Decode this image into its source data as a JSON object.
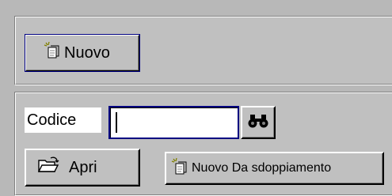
{
  "top_section": {
    "new_button_label": "Nuovo"
  },
  "search_section": {
    "code_label": "Codice",
    "code_value": "",
    "search_icon": "binoculars-icon"
  },
  "actions": {
    "open_button_label": "Apri",
    "duplicate_button_label": "Nuovo Da sdoppiamento"
  },
  "icons": {
    "new": "new-document-sparkle-icon",
    "open": "open-folder-icon"
  }
}
